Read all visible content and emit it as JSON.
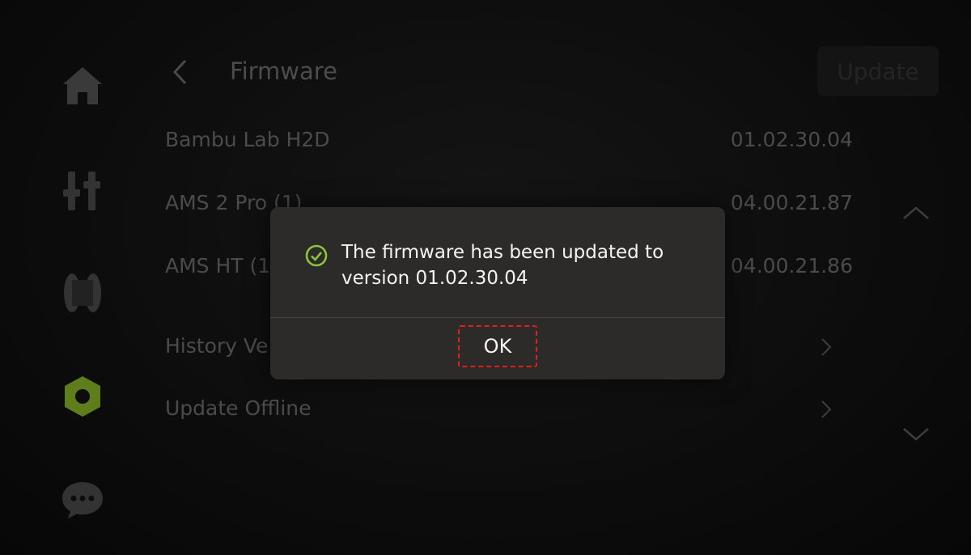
{
  "header": {
    "title": "Firmware",
    "update_label": "Update",
    "back_icon": "chevron-left-icon"
  },
  "sidebar": {
    "items": [
      {
        "icon": "home-icon"
      },
      {
        "icon": "sliders-icon"
      },
      {
        "icon": "filament-spool-icon"
      },
      {
        "icon": "settings-hexagon-icon",
        "active": true,
        "color": "#6a8a1e"
      },
      {
        "icon": "chat-icon"
      }
    ]
  },
  "firmware": {
    "rows": [
      {
        "name": "Bambu Lab H2D",
        "version": "01.02.30.04"
      },
      {
        "name": "AMS 2 Pro (1)",
        "version": "04.00.21.87"
      },
      {
        "name": "AMS HT (1",
        "version": "04.00.21.86"
      }
    ],
    "links": [
      {
        "label": "History Ve"
      },
      {
        "label": "Update Offline"
      }
    ]
  },
  "dialog": {
    "message": "The firmware has been updated to version 01.02.30.04",
    "ok_label": "OK",
    "icon": "check-circle-icon",
    "icon_color": "#8cc63e",
    "highlight_color": "#e0201c"
  }
}
